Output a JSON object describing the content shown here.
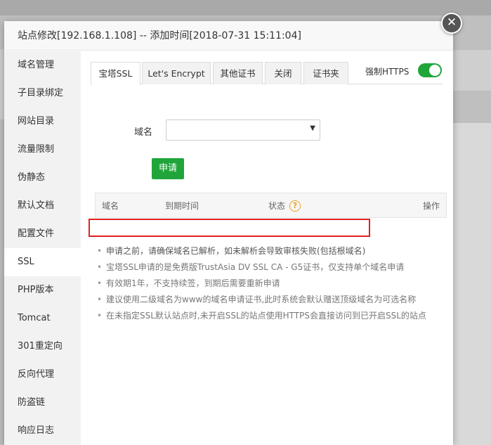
{
  "dialog": {
    "title": "站点修改[192.168.1.108] -- 添加时间[2018-07-31 15:11:04]",
    "close_glyph": "✕"
  },
  "sidebar": {
    "items": [
      {
        "label": "域名管理"
      },
      {
        "label": "子目录绑定"
      },
      {
        "label": "网站目录"
      },
      {
        "label": "流量限制"
      },
      {
        "label": "伪静态"
      },
      {
        "label": "默认文档"
      },
      {
        "label": "配置文件"
      },
      {
        "label": "SSL",
        "active": true
      },
      {
        "label": "PHP版本"
      },
      {
        "label": "Tomcat"
      },
      {
        "label": "301重定向"
      },
      {
        "label": "反向代理"
      },
      {
        "label": "防盗链"
      },
      {
        "label": "响应日志"
      }
    ]
  },
  "tabs": [
    {
      "label": "宝塔SSL",
      "active": true
    },
    {
      "label": "Let's Encrypt"
    },
    {
      "label": "其他证书"
    },
    {
      "label": "关闭"
    },
    {
      "label": "证书夹"
    }
  ],
  "force_https": {
    "label": "强制HTTPS",
    "on": true
  },
  "form": {
    "domain_label": "域名",
    "domain_value": "",
    "caret": "▼",
    "apply_label": "申请"
  },
  "table": {
    "headers": [
      "域名",
      "到期时间",
      "状态",
      "操作"
    ],
    "help_glyph": "?"
  },
  "tips": [
    "申请之前，请确保域名已解析，如未解析会导致审核失败(包括根域名)",
    "宝塔SSL申请的是免费版TrustAsia DV SSL CA - G5证书，仅支持单个域名申请",
    "有效期1年，不支持续签，到期后需要重新申请",
    "建议使用二级域名为www的域名申请证书,此时系统会默认赠送顶级域名为可选名称",
    "在未指定SSL默认站点时,未开启SSL的站点使用HTTPS会直接访问到已开启SSL的站点"
  ],
  "bullet": "•",
  "colors": {
    "accent": "#20a53a",
    "highlight": "#e02020",
    "help": "#f0a020"
  }
}
